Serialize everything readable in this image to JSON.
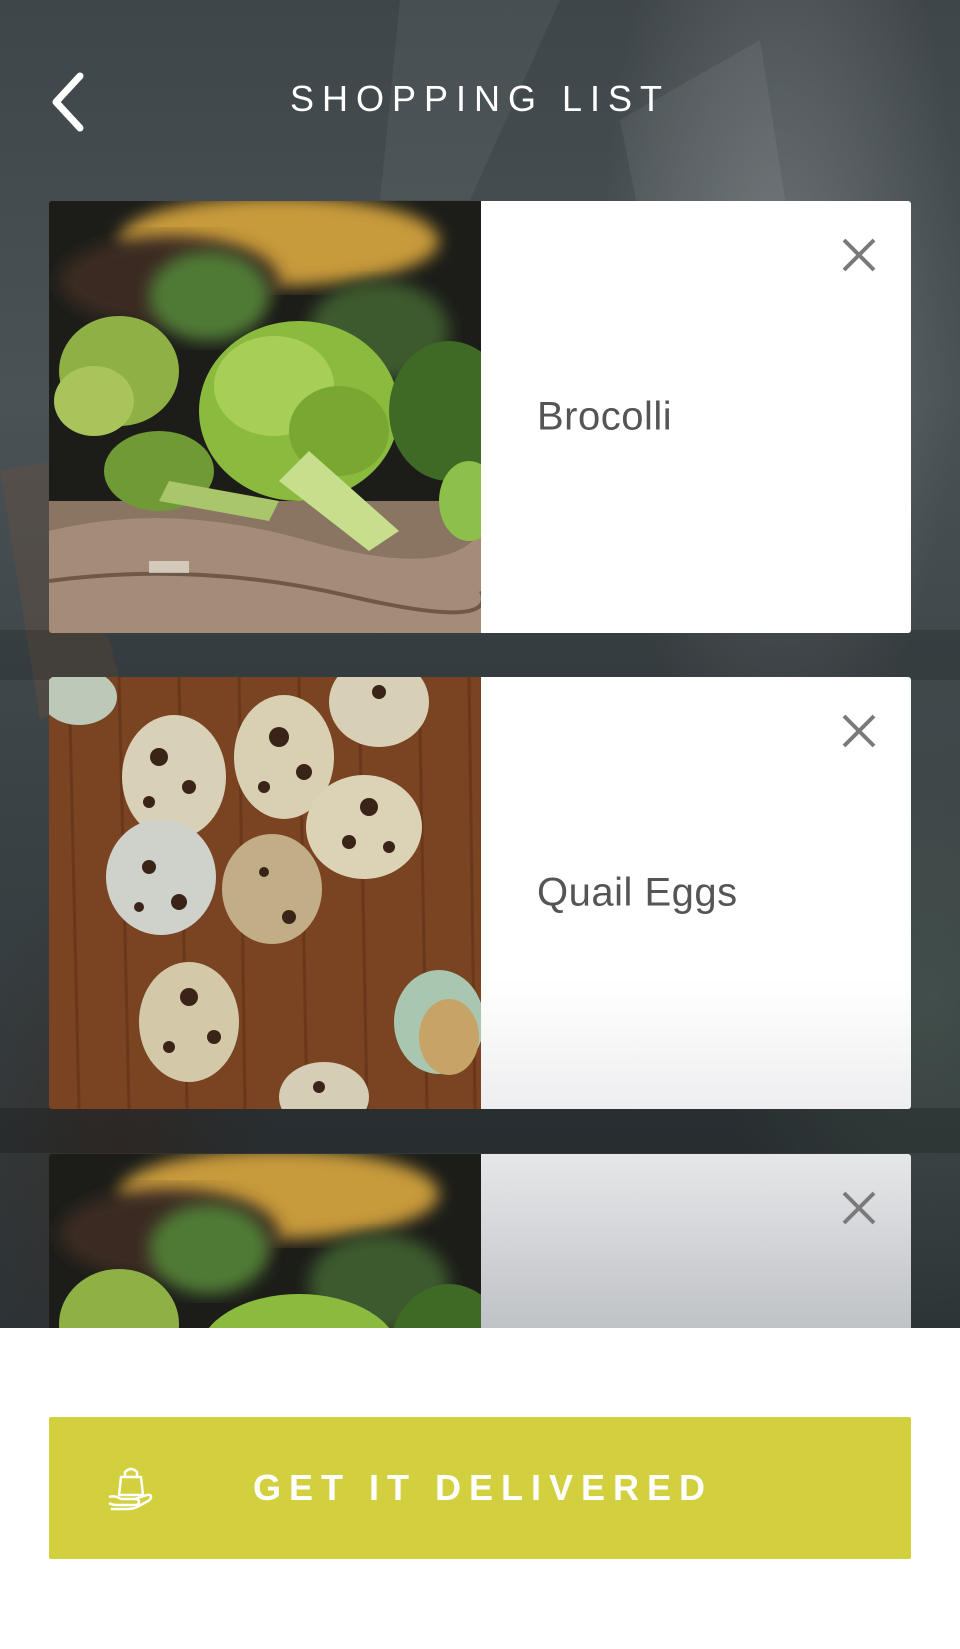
{
  "header": {
    "title": "SHOPPING LIST",
    "back_icon": "chevron-left-icon"
  },
  "items": [
    {
      "name": "Brocolli",
      "image": "broccoli",
      "remove_icon": "close-icon"
    },
    {
      "name": "Quail Eggs",
      "image": "quail-eggs",
      "remove_icon": "close-icon"
    },
    {
      "name": "",
      "image": "broccoli",
      "remove_icon": "close-icon"
    }
  ],
  "footer": {
    "button_label": "GET IT DELIVERED",
    "button_icon": "shopping-bag-hand-icon"
  },
  "colors": {
    "accent": "#d2d03e",
    "card": "#ffffff",
    "text": "#555555",
    "icon": "#7a7a7a"
  }
}
